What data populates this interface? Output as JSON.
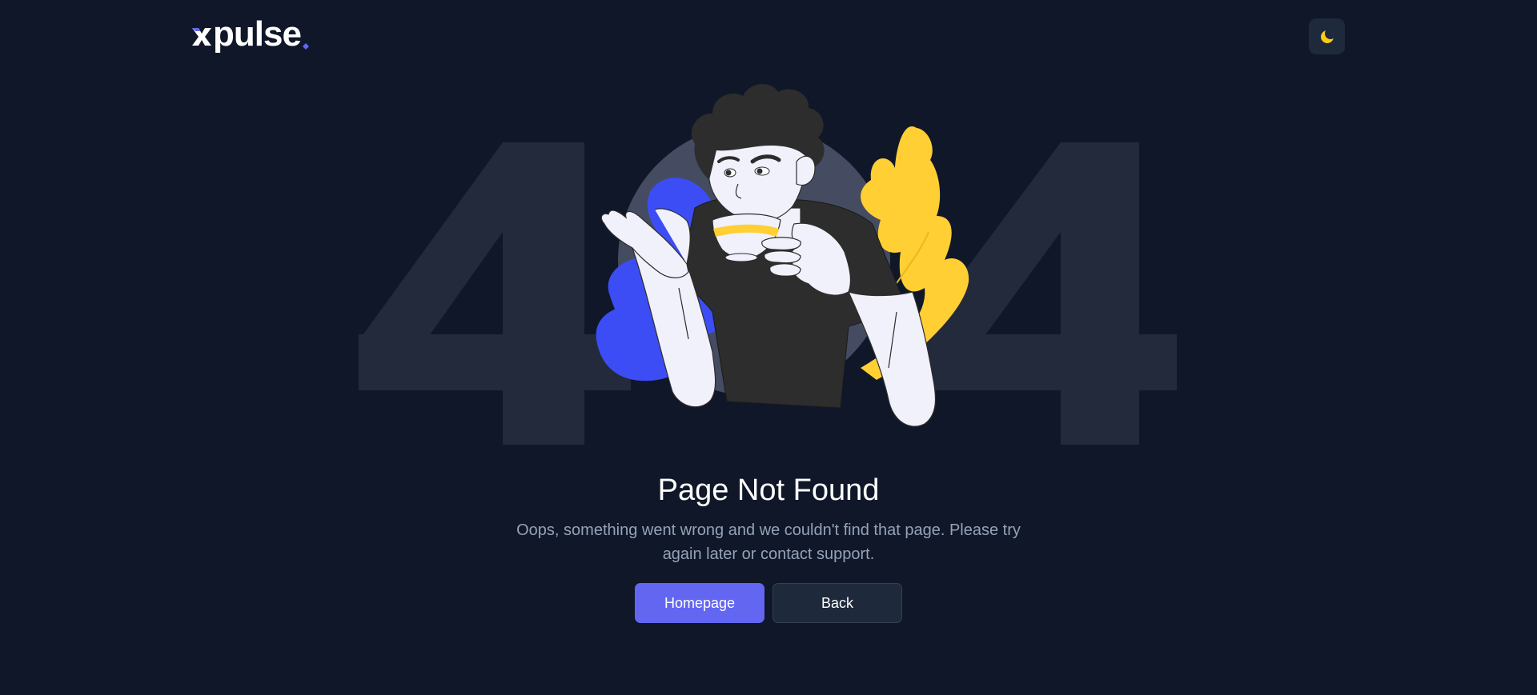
{
  "header": {
    "logo_text": "pulse",
    "theme_toggle_icon": "moon-icon"
  },
  "background": {
    "code_left": "4",
    "code_right": "4"
  },
  "main": {
    "title": "Page Not Found",
    "message_line1": "Oops, something went wrong and we couldn't find that page. Please try",
    "message_line2": "again later or contact support.",
    "homepage_label": "Homepage",
    "back_label": "Back"
  },
  "colors": {
    "background": "#101729",
    "accent": "#6366f1",
    "digit": "#222a3b",
    "blob_blue": "#3d4df5",
    "blob_yellow": "#ffcf33",
    "circle": "#454c61"
  }
}
